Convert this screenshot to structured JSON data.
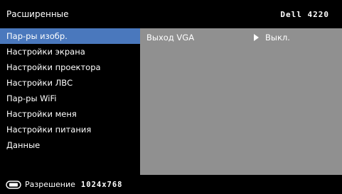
{
  "header": {
    "title": "Расширенные",
    "model": "Dell 4220"
  },
  "sidebar": {
    "items": [
      {
        "label": "Пар-ры изобр."
      },
      {
        "label": "Настройки экрана"
      },
      {
        "label": "Настройки проектора"
      },
      {
        "label": "Настройки ЛВС"
      },
      {
        "label": "Пар-ры WiFi"
      },
      {
        "label": "Настройки меня"
      },
      {
        "label": "Настройки питания"
      },
      {
        "label": "Данные"
      }
    ],
    "active_index": 0
  },
  "panel": {
    "rows": [
      {
        "label": "Выход VGA",
        "value": "Выкл."
      }
    ]
  },
  "footer": {
    "icon": "video-input-icon",
    "label": "Разрешение",
    "value": "1024x768"
  },
  "colors": {
    "background": "#000000",
    "active_item": "#4a78bd",
    "panel": "#909090"
  }
}
